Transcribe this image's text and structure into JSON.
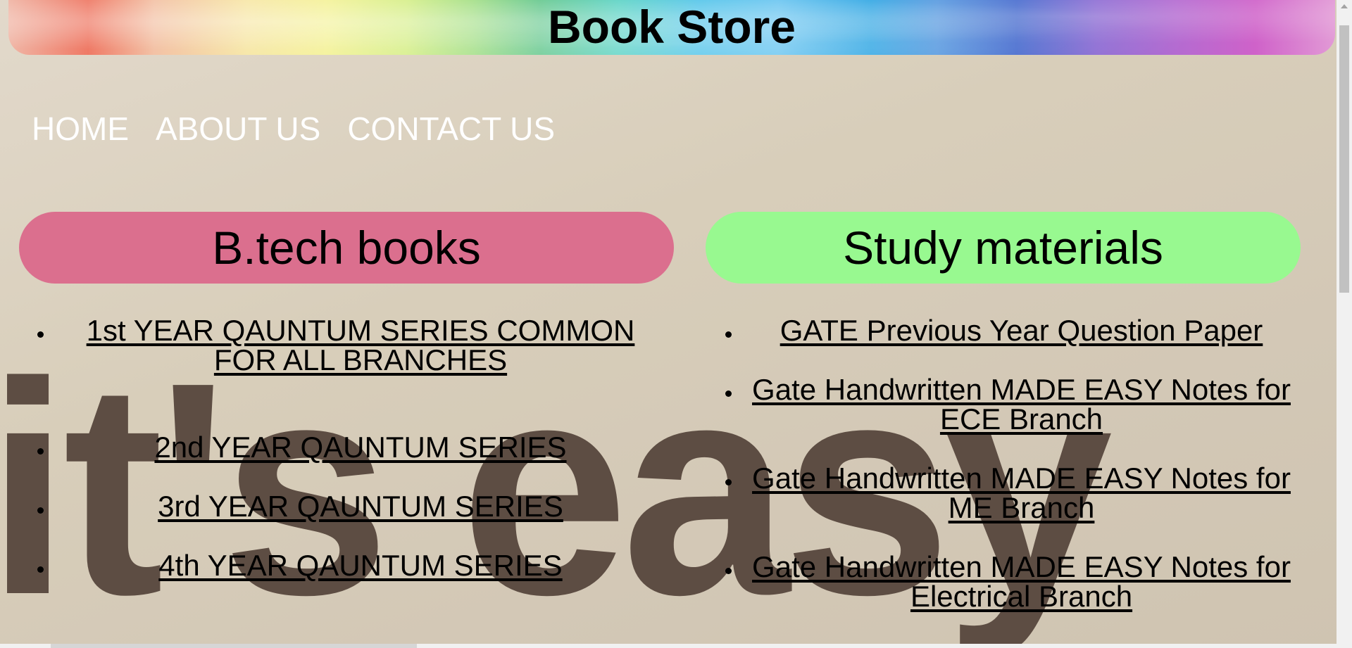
{
  "header": {
    "title": "Book Store"
  },
  "nav": {
    "items": [
      "HOME",
      "ABOUT US",
      "CONTACT US"
    ]
  },
  "backdrop": {
    "text": "it's easy"
  },
  "left_column": {
    "heading": "B.tech books",
    "links": [
      "1st YEAR QAUNTUM SERIES COMMON FOR ALL BRANCHES",
      "2nd YEAR QAUNTUM SERIES",
      "3rd YEAR QAUNTUM SERIES",
      "4th YEAR QAUNTUM SERIES"
    ]
  },
  "right_column": {
    "heading": "Study materials",
    "links": [
      "GATE Previous Year Question Paper",
      "Gate Handwritten MADE EASY Notes for ECE Branch",
      "Gate Handwritten MADE EASY Notes for ME Branch",
      "Gate Handwritten MADE EASY Notes for Electrical Branch"
    ]
  },
  "colors": {
    "btech_pill": "#db6f8e",
    "study_pill": "#98f990",
    "nav_text": "#ffffff"
  }
}
